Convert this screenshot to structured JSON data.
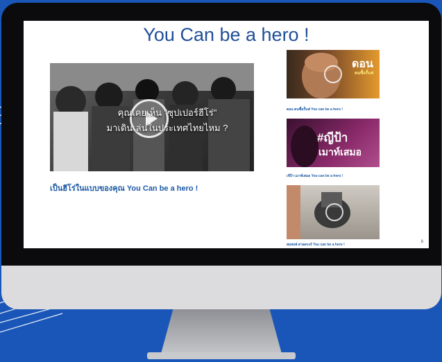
{
  "slide": {
    "title": "You Can be a hero !",
    "page_number": "8"
  },
  "main_video": {
    "caption_line1": "คุณเคยเห็น \"ซุปเปอร์ฮีโร่\"",
    "caption_line2": "มาเดินเล่นในประเทศไทยไหม ?",
    "description": "เป็นฮีโร่ในแบบของคุณ You Can be a hero !"
  },
  "thumbnails": [
    {
      "overlay": "ดอน",
      "overlay_sub": "คนซื้อรั้นฟ",
      "caption": "ดอน คนซื้อรั้นฟ You can be a hero !"
    },
    {
      "overlay": "#ญีป้า",
      "overlay_sub": "เมาท์เสมอ",
      "caption": "เจ๊ป้า เมาท์เสมอ You can be a hero !"
    },
    {
      "overlay": "",
      "overlay_sub": "",
      "caption": "สมพงษ์ สายตรงร์ You can be a hero !"
    }
  ]
}
